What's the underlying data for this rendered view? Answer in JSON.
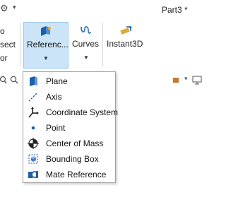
{
  "window": {
    "title": "Part3 *"
  },
  "ribbon": {
    "left_fragments": [
      "o",
      "sect",
      "or"
    ],
    "reference_geometry": {
      "label": "Referenc..."
    },
    "curves": {
      "label": "Curves"
    },
    "instant3d": {
      "label": "Instant3D"
    }
  },
  "reference_menu": {
    "items": [
      {
        "label": "Plane",
        "icon": "plane-icon"
      },
      {
        "label": "Axis",
        "icon": "axis-icon"
      },
      {
        "label": "Coordinate System",
        "icon": "coordinate-system-icon"
      },
      {
        "label": "Point",
        "icon": "point-icon"
      },
      {
        "label": "Center of Mass",
        "icon": "center-of-mass-icon"
      },
      {
        "label": "Bounding Box",
        "icon": "bounding-box-icon"
      },
      {
        "label": "Mate Reference",
        "icon": "mate-reference-icon"
      }
    ]
  },
  "colors": {
    "selected_button_bg": "#cce4f7",
    "selected_button_border": "#99c9ee",
    "icon_blue": "#1f5ea8"
  }
}
